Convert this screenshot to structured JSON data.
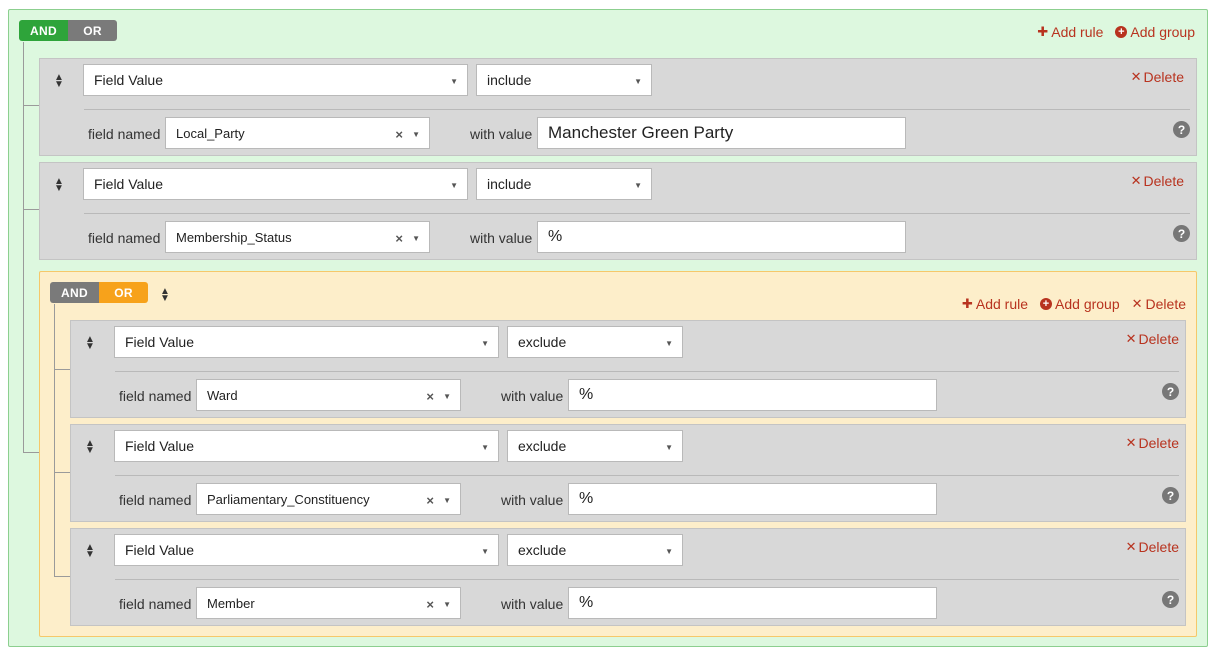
{
  "outer": {
    "and_label": "AND",
    "or_label": "OR",
    "add_rule": "Add rule",
    "add_group": "Add group"
  },
  "rules": [
    {
      "type": "Field Value",
      "operator": "include",
      "field_label": "field named",
      "field": "Local_Party",
      "value_label": "with value",
      "value": "Manchester Green Party",
      "delete": "Delete"
    },
    {
      "type": "Field Value",
      "operator": "include",
      "field_label": "field named",
      "field": "Membership_Status",
      "value_label": "with value",
      "value": "%",
      "delete": "Delete"
    }
  ],
  "inner": {
    "and_label": "AND",
    "or_label": "OR",
    "add_rule": "Add rule",
    "add_group": "Add group",
    "delete": "Delete",
    "rules": [
      {
        "type": "Field Value",
        "operator": "exclude",
        "field_label": "field named",
        "field": "Ward",
        "value_label": "with value",
        "value": "%",
        "delete": "Delete"
      },
      {
        "type": "Field Value",
        "operator": "exclude",
        "field_label": "field named",
        "field": "Parliamentary_Constituency",
        "value_label": "with value",
        "value": "%",
        "delete": "Delete"
      },
      {
        "type": "Field Value",
        "operator": "exclude",
        "field_label": "field named",
        "field": "Member",
        "value_label": "with value",
        "value": "%",
        "delete": "Delete"
      }
    ]
  },
  "colors": {
    "and_active": "#2ea43a",
    "or_active": "#f7a21b",
    "inactive": "#7a7a7a",
    "action": "#b8331f"
  },
  "icons": {
    "drag": "sort-icon",
    "help": "question-circle-icon",
    "delete": "times-icon",
    "add_rule": "plus-icon",
    "add_group": "plus-circle-icon"
  }
}
